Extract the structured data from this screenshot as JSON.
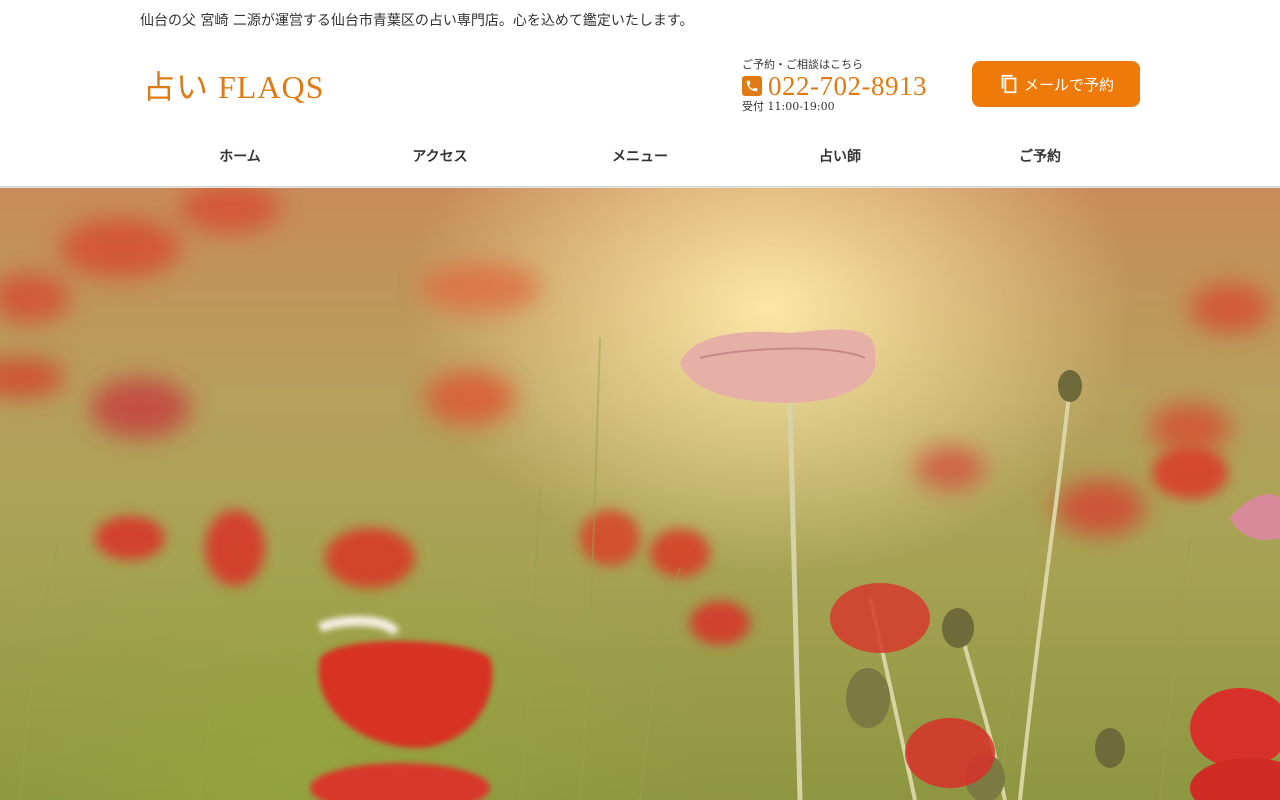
{
  "header": {
    "tagline": "仙台の父 宮崎 二源が運営する仙台市青葉区の占い専門店。心を込めて鑑定いたします。",
    "logo_text": "占い FLAQS",
    "contact": {
      "lead": "ご予約・ご相談はこちら",
      "phone": "022-702-8913",
      "hours": "受付 11:00-19:00"
    },
    "mail_button_label": "メールで予約",
    "accent_color": "#ee7a0a"
  },
  "nav": {
    "items": [
      {
        "label": "ホーム"
      },
      {
        "label": "アクセス"
      },
      {
        "label": "メニュー"
      },
      {
        "label": "占い師"
      },
      {
        "label": "ご予約"
      }
    ]
  },
  "hero": {
    "image_icon": "poppy-field-photo"
  }
}
